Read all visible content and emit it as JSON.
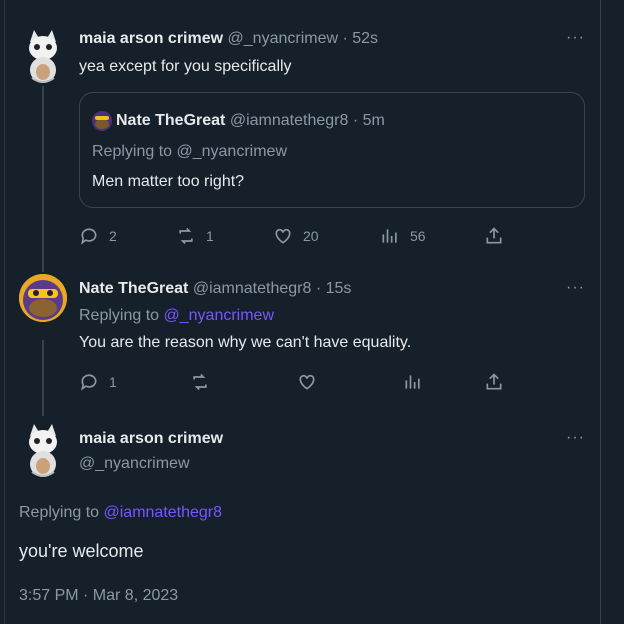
{
  "tweet1": {
    "name": "maia arson crimew",
    "handle": "@_nyancrimew",
    "time": "· 52s",
    "text": "yea except for you specifically",
    "quote": {
      "name": "Nate TheGreat",
      "handle": "@iamnatethegr8",
      "time": "· 5m",
      "replying": "Replying to @_nyancrimew",
      "text": "Men matter too right?"
    },
    "actions": {
      "replies": "2",
      "retweets": "1",
      "likes": "20",
      "views": "56"
    }
  },
  "tweet2": {
    "name": "Nate TheGreat",
    "handle": "@iamnatethegr8",
    "time": "· 15s",
    "replying_prefix": "Replying to",
    "replying_handle": "@_nyancrimew",
    "text": "You are the reason why we can't have equality.",
    "actions": {
      "replies": "1",
      "retweets": "",
      "likes": "",
      "views": ""
    }
  },
  "main": {
    "name": "maia arson crimew",
    "handle": "@_nyancrimew",
    "replying_prefix": "Replying to",
    "replying_handle": "@iamnatethegr8",
    "text": "you're welcome",
    "timestamp": "3:57 PM · Mar 8, 2023"
  },
  "more_label": "···",
  "colors": {
    "background": "#15202b",
    "link": "#7856ff",
    "muted": "#8b98a5",
    "border": "#38444d"
  },
  "icons": [
    "reply-icon",
    "retweet-icon",
    "like-icon",
    "views-icon",
    "share-icon",
    "more-icon"
  ]
}
